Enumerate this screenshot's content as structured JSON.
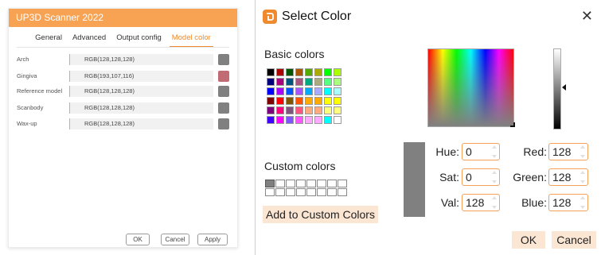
{
  "settings": {
    "title": "UP3D Scanner 2022",
    "tabs": [
      {
        "label": "General"
      },
      {
        "label": "Advanced"
      },
      {
        "label": "Output config"
      },
      {
        "label": "Model color"
      }
    ],
    "rows": [
      {
        "label": "Arch",
        "value": "RGB(128,128,128)",
        "color": "#808080"
      },
      {
        "label": "Gingiva",
        "value": "RGB(193,107,116)",
        "color": "#c16b74"
      },
      {
        "label": "Reference model",
        "value": "RGB(128,128,128)",
        "color": "#808080"
      },
      {
        "label": "Scanbody",
        "value": "RGB(128,128,128)",
        "color": "#808080"
      },
      {
        "label": "Wax-up",
        "value": "RGB(128,128,128)",
        "color": "#808080"
      }
    ],
    "buttons": {
      "ok": "OK",
      "cancel": "Cancel",
      "apply": "Apply"
    },
    "accent": "#f7a353"
  },
  "dialog": {
    "title": "Select Color",
    "close_icon": "close-icon",
    "basic_colors_label": "Basic colors",
    "custom_colors_label": "Custom colors",
    "add_button": "Add to Custom Colors",
    "basic_colors": [
      "#000000",
      "#aa0000",
      "#005500",
      "#aa5500",
      "#55aa00",
      "#aaaa00",
      "#00ff00",
      "#aaff00",
      "#00007f",
      "#aa007f",
      "#00557f",
      "#aa557f",
      "#00aa7f",
      "#aaaa7f",
      "#55ff7f",
      "#aaff7f",
      "#0000ff",
      "#aa00ff",
      "#0055ff",
      "#aa55ff",
      "#00aaff",
      "#aaaaff",
      "#00ffff",
      "#aaffff",
      "#7f0000",
      "#ff0000",
      "#7f5500",
      "#ff5500",
      "#ffaa00",
      "#ffaa00",
      "#ffff00",
      "#ffff00",
      "#7f007f",
      "#ff007f",
      "#7f557f",
      "#ff557f",
      "#ffaa7f",
      "#ffaa7f",
      "#ffff7f",
      "#ffff7f",
      "#3f00ff",
      "#ff00ff",
      "#7f55ff",
      "#ff55ff",
      "#ffaaff",
      "#ffaaff",
      "#00ffff",
      "#ffffff"
    ],
    "custom_colors": [
      "#808080",
      "#ffffff",
      "#ffffff",
      "#ffffff",
      "#ffffff",
      "#ffffff",
      "#ffffff",
      "#ffffff",
      "#ffffff",
      "#ffffff",
      "#ffffff",
      "#ffffff",
      "#ffffff",
      "#ffffff",
      "#ffffff",
      "#ffffff"
    ],
    "current_color": "#808080",
    "fields": {
      "hue": {
        "label": "Hue:",
        "value": "0"
      },
      "sat": {
        "label": "Sat:",
        "value": "0"
      },
      "val": {
        "label": "Val:",
        "value": "128"
      },
      "red": {
        "label": "Red:",
        "value": "128"
      },
      "green": {
        "label": "Green:",
        "value": "128"
      },
      "blue": {
        "label": "Blue:",
        "value": "128"
      }
    },
    "ok": "OK",
    "cancel": "Cancel",
    "accent": "#f08a2e"
  }
}
